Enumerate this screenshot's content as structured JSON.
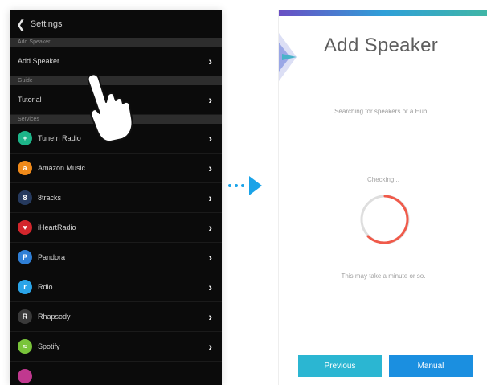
{
  "left": {
    "nav_title": "Settings",
    "sections": [
      {
        "header": "Add Speaker",
        "items": [
          {
            "label": "Add Speaker"
          }
        ]
      },
      {
        "header": "Guide",
        "items": [
          {
            "label": "Tutorial"
          }
        ]
      },
      {
        "header": "Services",
        "items": [
          {
            "label": "TuneIn Radio",
            "icon": "tunein-icon",
            "color": "#1db589"
          },
          {
            "label": "Amazon Music",
            "icon": "amazon-icon",
            "color": "#f08a1a"
          },
          {
            "label": "8tracks",
            "icon": "8tracks-icon",
            "color": "#263a5e"
          },
          {
            "label": "iHeartRadio",
            "icon": "iheartradio-icon",
            "color": "#d3262c"
          },
          {
            "label": "Pandora",
            "icon": "pandora-icon",
            "color": "#2f7fd6"
          },
          {
            "label": "Rdio",
            "icon": "rdio-icon",
            "color": "#2aa4e8"
          },
          {
            "label": "Rhapsody",
            "icon": "rhapsody-icon",
            "color": "#3a3a3a"
          },
          {
            "label": "Spotify",
            "icon": "spotify-icon",
            "color": "#79c43a"
          }
        ]
      }
    ]
  },
  "right": {
    "title": "Add Speaker",
    "searching_text": "Searching for speakers or a Hub...",
    "checking_text": "Checking...",
    "wait_text": "This may take a minute or so.",
    "previous_label": "Previous",
    "manual_label": "Manual",
    "spinner_color": "#f05a4a"
  }
}
